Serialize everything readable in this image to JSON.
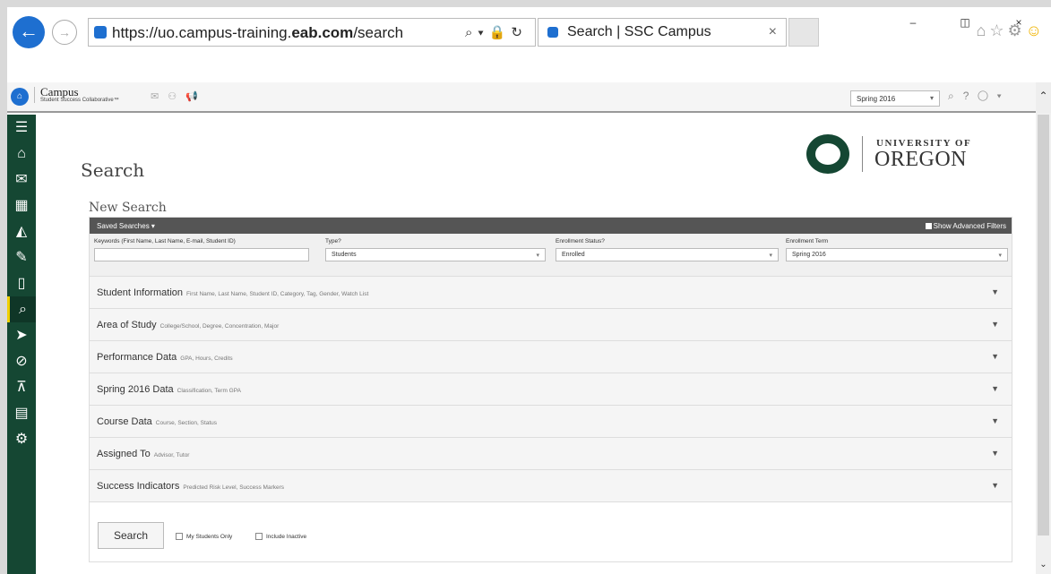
{
  "browser": {
    "url_prefix": "https://uo.campus-training.",
    "url_domain": "eab.com",
    "url_path": "/search",
    "tab_title": "Search | SSC Campus",
    "minimize": "–",
    "restore": "◫",
    "close": "×"
  },
  "app": {
    "brand_name": "Campus",
    "brand_sub": "Student Success Collaborative™",
    "term": "Spring 2016",
    "help": "?"
  },
  "page": {
    "title": "Search",
    "section_title": "New Search",
    "logo_line1": "UNIVERSITY OF",
    "logo_line2": "OREGON"
  },
  "panel": {
    "saved_searches": "Saved Searches ▾",
    "show_advanced": "Show Advanced Filters",
    "filters": {
      "keywords_label": "Keywords (First Name, Last Name, E-mail, Student ID)",
      "keywords_value": "",
      "type_label": "Type?",
      "type_value": "Students",
      "status_label": "Enrollment Status?",
      "status_value": "Enrolled",
      "term_label": "Enrollment Term",
      "term_value": "Spring 2016"
    },
    "sections": [
      {
        "title": "Student Information",
        "sub": "First Name, Last Name, Student ID, Category, Tag, Gender, Watch List"
      },
      {
        "title": "Area of Study",
        "sub": "College/School, Degree, Concentration, Major"
      },
      {
        "title": "Performance Data",
        "sub": "GPA, Hours, Credits"
      },
      {
        "title": "Spring 2016 Data",
        "sub": "Classification, Term GPA"
      },
      {
        "title": "Course Data",
        "sub": "Course, Section, Status"
      },
      {
        "title": "Assigned To",
        "sub": "Advisor, Tutor"
      },
      {
        "title": "Success Indicators",
        "sub": "Predicted Risk Level, Success Markers"
      }
    ],
    "search_button": "Search",
    "my_students_only": "My Students Only",
    "include_inactive": "Include Inactive"
  },
  "sidebar_icons": [
    "menu-icon",
    "home-icon",
    "mail-icon",
    "calendar-icon",
    "chart-icon",
    "pin-icon",
    "book-icon",
    "search-icon",
    "megaphone-icon",
    "pulse-icon",
    "presentation-icon",
    "document-icon",
    "gear-icon"
  ]
}
